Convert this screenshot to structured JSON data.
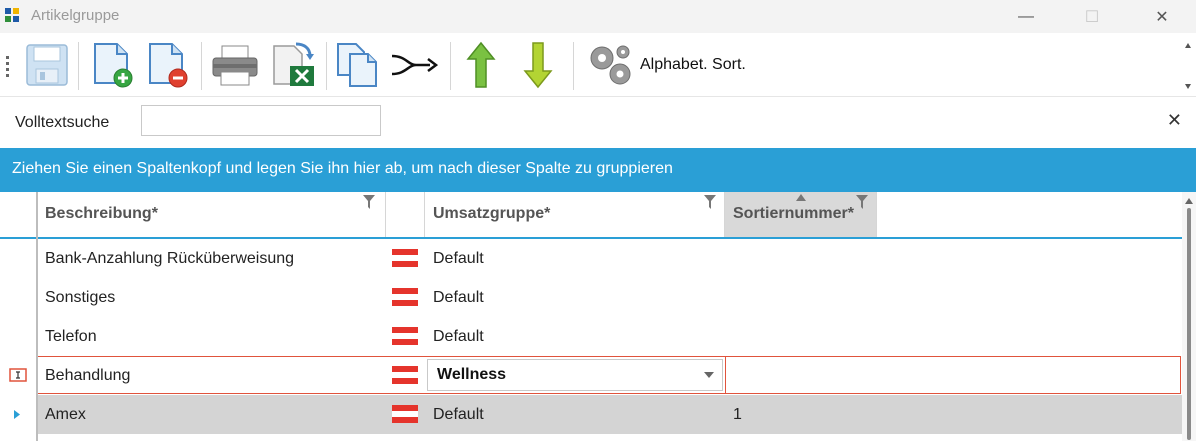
{
  "window": {
    "title": "Artikelgruppe",
    "controls": {
      "minimize": "—",
      "maximize": "☐",
      "close": "✕"
    }
  },
  "toolbar": {
    "buttons": [
      {
        "icon": "save-icon"
      },
      {
        "icon": "add-document-icon"
      },
      {
        "icon": "remove-document-icon"
      },
      {
        "icon": "printer-icon"
      },
      {
        "icon": "excel-export-icon"
      },
      {
        "icon": "copy-document-icon"
      },
      {
        "icon": "merge-arrow-icon"
      },
      {
        "icon": "move-up-icon"
      },
      {
        "icon": "move-down-icon"
      },
      {
        "icon": "gears-icon",
        "label": "Alphabet. Sort."
      }
    ]
  },
  "search": {
    "label": "Volltextsuche",
    "value": "",
    "close": "✕"
  },
  "group_panel": {
    "text": "Ziehen Sie einen Spaltenkopf und legen Sie ihn hier ab, um nach dieser Spalte zu gruppieren"
  },
  "grid": {
    "columns": [
      {
        "label": "Beschreibung*"
      },
      {
        "label": ""
      },
      {
        "label": "Umsatzgruppe*"
      },
      {
        "label": "Sortiernummer*"
      }
    ],
    "rows": [
      {
        "beschreibung": "Bank-Anzahlung Rücküberweisung",
        "umsatzgruppe": "Default",
        "sortiernummer": ""
      },
      {
        "beschreibung": "Sonstiges",
        "umsatzgruppe": "Default",
        "sortiernummer": ""
      },
      {
        "beschreibung": "Telefon",
        "umsatzgruppe": "Default",
        "sortiernummer": ""
      },
      {
        "beschreibung": "Behandlung",
        "umsatzgruppe": "Wellness",
        "sortiernummer": "",
        "editing": true
      },
      {
        "beschreibung": "Amex",
        "umsatzgruppe": "Default",
        "sortiernummer": "1",
        "current": true
      }
    ]
  },
  "colors": {
    "accent": "#2a9fd6",
    "edit_border": "#e0533c",
    "selected_row": "#d4d4d4",
    "flag_red": "#e5342c"
  }
}
